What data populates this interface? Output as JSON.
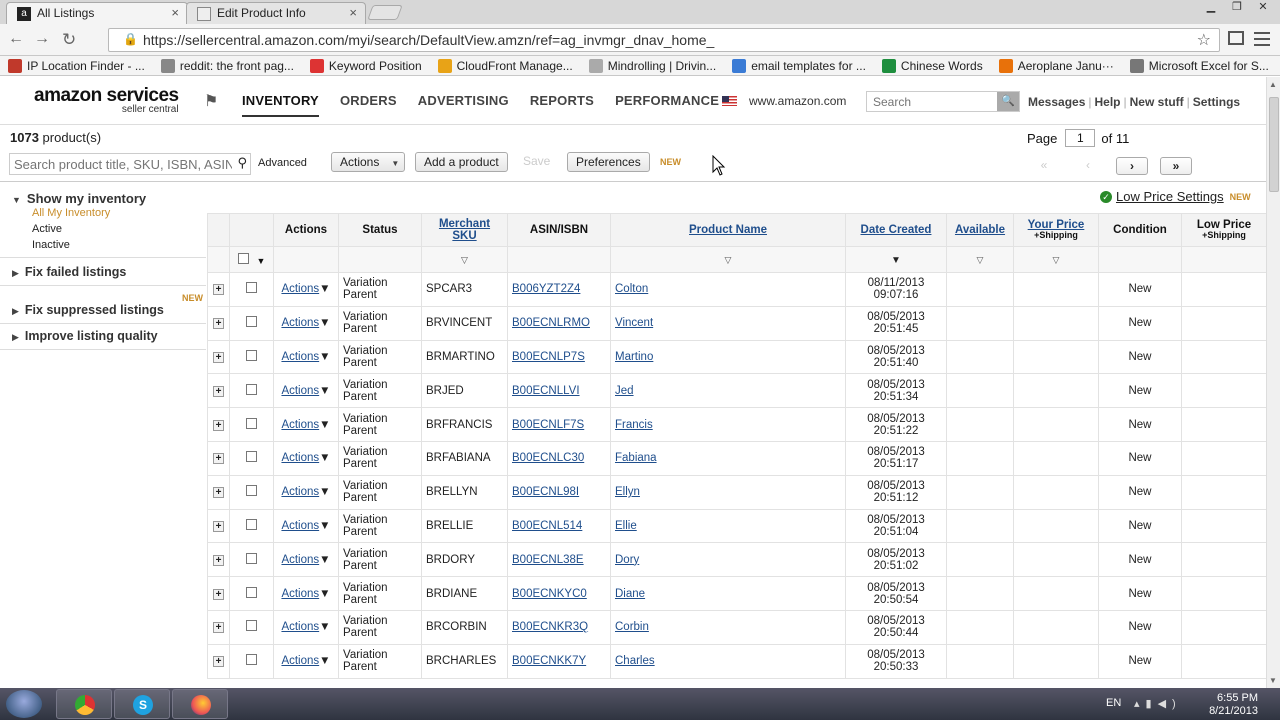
{
  "browser": {
    "tabs": [
      {
        "title": "All Listings",
        "active": true
      },
      {
        "title": "Edit Product Info",
        "active": false
      }
    ],
    "url": "https://sellercentral.amazon.com/myi/search/DefaultView.amzn/ref=ag_invmgr_dnav_home_",
    "bookmarks": [
      {
        "label": "IP Location Finder - ...",
        "icon": "pin-icon",
        "color": "#c0392b"
      },
      {
        "label": "reddit: the front pag...",
        "icon": "reddit-icon",
        "color": "#888888"
      },
      {
        "label": "Keyword Position",
        "icon": "s-icon",
        "color": "#d33"
      },
      {
        "label": "CloudFront Manage...",
        "icon": "cloud-icon",
        "color": "#e8a317"
      },
      {
        "label": "Mindrolling | Drivin...",
        "icon": "page-icon",
        "color": "#aaaaaa"
      },
      {
        "label": "email templates for ...",
        "icon": "mail-icon",
        "color": "#3a7bd5"
      },
      {
        "label": "Chinese Words",
        "icon": "sheet-icon",
        "color": "#1e8e3e"
      },
      {
        "label": "Aeroplane Janu···",
        "icon": "play-icon",
        "color": "#e8710a"
      },
      {
        "label": "Microsoft Excel for S...",
        "icon": "puzzle-icon",
        "color": "#777777"
      }
    ]
  },
  "header": {
    "logo_main": "amazon services",
    "logo_sub": "seller central",
    "nav": [
      "INVENTORY",
      "ORDERS",
      "ADVERTISING",
      "REPORTS",
      "PERFORMANCE"
    ],
    "marketplace": "www.amazon.com",
    "search_placeholder": "Search",
    "links": [
      "Messages",
      "Help",
      "New stuff",
      "Settings"
    ]
  },
  "toolbar": {
    "product_count": "1073",
    "product_count_suffix": "product(s)",
    "search_placeholder": "Search product title, SKU, ISBN, ASIN",
    "advanced": "Advanced",
    "actions": "Actions",
    "add_product": "Add a product",
    "save": "Save",
    "preferences": "Preferences",
    "new_tag": "NEW",
    "page_label": "Page",
    "page_value": "1",
    "page_total": "of 11"
  },
  "sidebar": {
    "show_inventory": "Show my inventory",
    "items": [
      "All My Inventory",
      "Active",
      "Inactive"
    ],
    "fix_failed": "Fix failed listings",
    "fix_suppressed": "Fix suppressed listings",
    "improve": "Improve listing quality",
    "new_tag": "NEW"
  },
  "low_price": {
    "label": "Low Price Settings",
    "new_tag": "NEW"
  },
  "table": {
    "headers": {
      "actions": "Actions",
      "status": "Status",
      "sku1": "Merchant",
      "sku2": "SKU",
      "asin": "ASIN/ISBN",
      "name": "Product Name",
      "date": "Date Created",
      "available": "Available",
      "price1": "Your Price",
      "price2": "+Shipping",
      "condition": "Condition",
      "low1": "Low Price",
      "low2": "+Shipping"
    },
    "rows": [
      {
        "action": "Actions",
        "status1": "Variation",
        "status2": "Parent",
        "sku": "SPCAR3",
        "asin": "B006YZT2Z4",
        "name": "Colton",
        "date": "08/11/2013",
        "time": "09:07:16",
        "condition": "New"
      },
      {
        "action": "Actions",
        "status1": "Variation",
        "status2": "Parent",
        "sku": "BRVINCENT",
        "asin": "B00ECNLRMO",
        "name": "Vincent",
        "date": "08/05/2013",
        "time": "20:51:45",
        "condition": "New"
      },
      {
        "action": "Actions",
        "status1": "Variation",
        "status2": "Parent",
        "sku": "BRMARTINO",
        "asin": "B00ECNLP7S",
        "name": "Martino",
        "date": "08/05/2013",
        "time": "20:51:40",
        "condition": "New"
      },
      {
        "action": "Actions",
        "status1": "Variation",
        "status2": "Parent",
        "sku": "BRJED",
        "asin": "B00ECNLLVI",
        "name": "Jed",
        "date": "08/05/2013",
        "time": "20:51:34",
        "condition": "New"
      },
      {
        "action": "Actions",
        "status1": "Variation",
        "status2": "Parent",
        "sku": "BRFRANCIS",
        "asin": "B00ECNLF7S",
        "name": "Francis",
        "date": "08/05/2013",
        "time": "20:51:22",
        "condition": "New"
      },
      {
        "action": "Actions",
        "status1": "Variation",
        "status2": "Parent",
        "sku": "BRFABIANA",
        "asin": "B00ECNLC30",
        "name": "Fabiana",
        "date": "08/05/2013",
        "time": "20:51:17",
        "condition": "New"
      },
      {
        "action": "Actions",
        "status1": "Variation",
        "status2": "Parent",
        "sku": "BRELLYN",
        "asin": "B00ECNL98I",
        "name": "Ellyn",
        "date": "08/05/2013",
        "time": "20:51:12",
        "condition": "New"
      },
      {
        "action": "Actions",
        "status1": "Variation",
        "status2": "Parent",
        "sku": "BRELLIE",
        "asin": "B00ECNL514",
        "name": "Ellie",
        "date": "08/05/2013",
        "time": "20:51:04",
        "condition": "New"
      },
      {
        "action": "Actions",
        "status1": "Variation",
        "status2": "Parent",
        "sku": "BRDORY",
        "asin": "B00ECNL38E",
        "name": "Dory",
        "date": "08/05/2013",
        "time": "20:51:02",
        "condition": "New"
      },
      {
        "action": "Actions",
        "status1": "Variation",
        "status2": "Parent",
        "sku": "BRDIANE",
        "asin": "B00ECNKYC0",
        "name": "Diane",
        "date": "08/05/2013",
        "time": "20:50:54",
        "condition": "New"
      },
      {
        "action": "Actions",
        "status1": "Variation",
        "status2": "Parent",
        "sku": "BRCORBIN",
        "asin": "B00ECNKR3Q",
        "name": "Corbin",
        "date": "08/05/2013",
        "time": "20:50:44",
        "condition": "New"
      },
      {
        "action": "Actions",
        "status1": "Variation",
        "status2": "Parent",
        "sku": "BRCHARLES",
        "asin": "B00ECNKK7Y",
        "name": "Charles",
        "date": "08/05/2013",
        "time": "20:50:33",
        "condition": "New"
      }
    ]
  },
  "taskbar": {
    "lang": "EN",
    "time": "6:55 PM",
    "date": "8/21/2013"
  }
}
